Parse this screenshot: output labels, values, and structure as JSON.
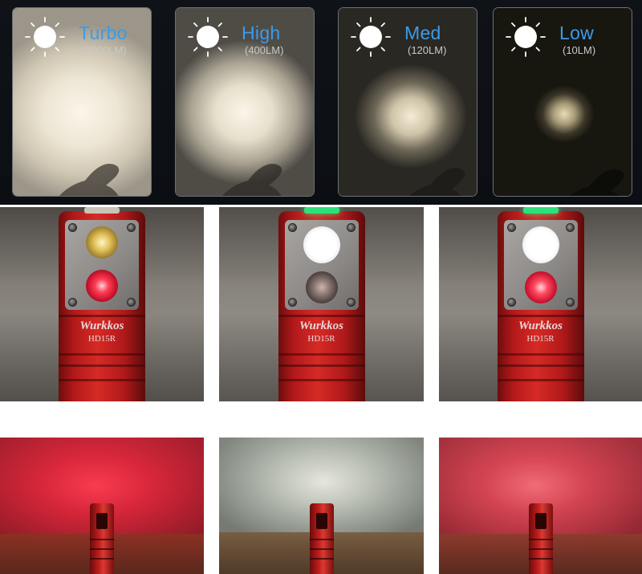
{
  "colors": {
    "mode_text": "#3d9be8",
    "lumen_text": "#c9c9c9",
    "torch_red": "#c81f1e",
    "led_green": "#2fe07a"
  },
  "modes": [
    {
      "name": "Turbo",
      "lumens": "(1000LM)"
    },
    {
      "name": "High",
      "lumens": "(400LM)"
    },
    {
      "name": "Med",
      "lumens": "(120LM)"
    },
    {
      "name": "Low",
      "lumens": "(10LM)"
    }
  ],
  "product": {
    "brand": "Wurkkos",
    "model": "HD15R"
  },
  "icons": {
    "mode_icon": "sun-icon"
  }
}
